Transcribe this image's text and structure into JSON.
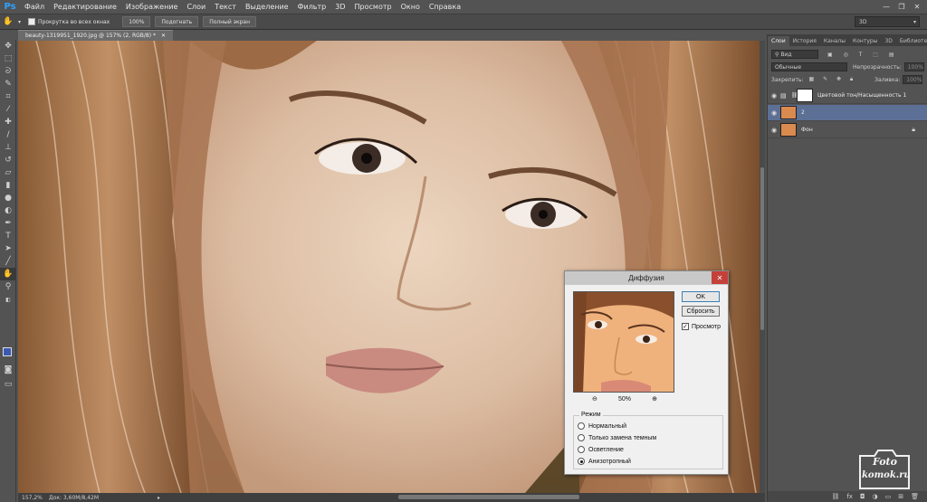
{
  "menubar": {
    "logo": "Ps",
    "items": [
      "Файл",
      "Редактирование",
      "Изображение",
      "Слои",
      "Текст",
      "Выделение",
      "Фильтр",
      "3D",
      "Просмотр",
      "Окно",
      "Справка"
    ]
  },
  "options": {
    "scroll_all_label": "Прокрутка во всех окнах",
    "zoom100": "100%",
    "fit": "Подогнать",
    "fullscreen": "Полный экран",
    "workspace": "3D"
  },
  "document": {
    "tab_title": "beauty-1319951_1920.jpg @ 157% (2, RGB/8) *",
    "zoom": "157,2%",
    "doc_size": "Док: 3,60M/8,42M"
  },
  "layers_panel": {
    "tabs": [
      "Слои",
      "История",
      "Каналы",
      "Контуры",
      "3D",
      "Библиотеки"
    ],
    "filter": "Вид",
    "blend_mode": "Обычные",
    "opacity_label": "Непрозрачность:",
    "opacity_value": "100%",
    "lock_label": "Закрепить:",
    "fill_label": "Заливка:",
    "fill_value": "100%",
    "layers": [
      {
        "name": "Цветовой тон/Насыщенность 1",
        "selected": false
      },
      {
        "name": "2",
        "selected": true
      },
      {
        "name": "Фон",
        "selected": false
      }
    ]
  },
  "dialog": {
    "title": "Диффузия",
    "ok": "OK",
    "reset": "Сбросить",
    "preview_label": "Просмотр",
    "zoom": "50%",
    "mode_label": "Режим",
    "modes": [
      "Нормальный",
      "Только замена темным",
      "Осветление",
      "Анизотропный"
    ],
    "selected_mode": "Анизотропный"
  },
  "watermark": {
    "line1": "Foto",
    "line2": "komok.ru"
  },
  "colors": {
    "foreground": "#3c58b4",
    "background": "#ffffff",
    "selected_layer": "#5c7096"
  }
}
